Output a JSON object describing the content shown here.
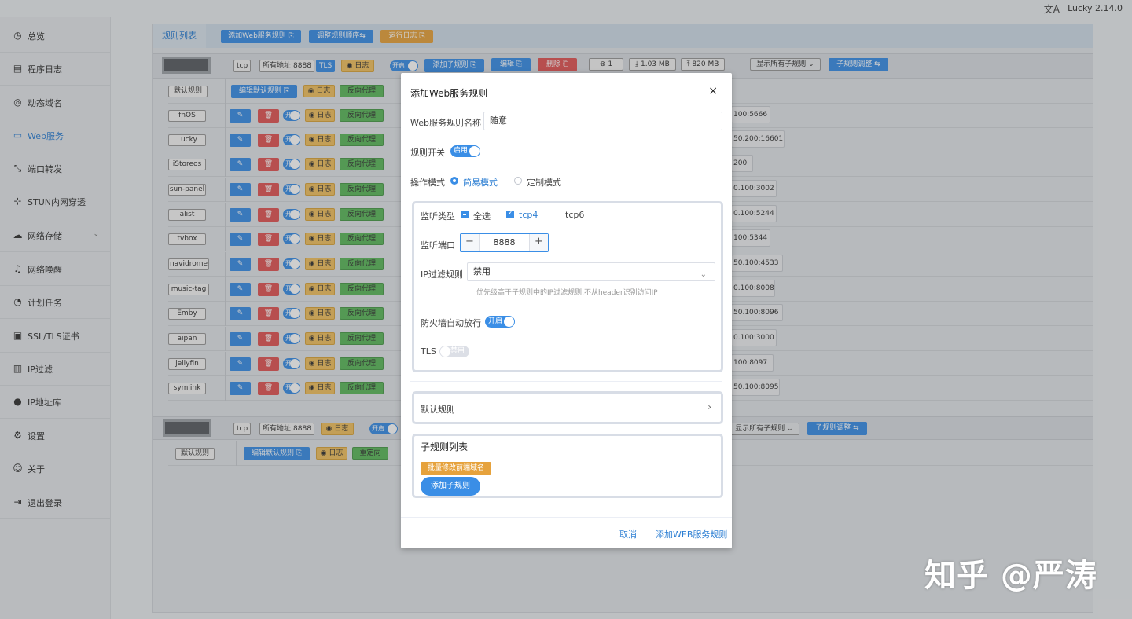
{
  "topbar": {
    "lang_icon": "文A",
    "version": "Lucky 2.14.0"
  },
  "sidebar": {
    "items": [
      {
        "label": "总览",
        "icon": "dashboard-icon",
        "glyph": "◷"
      },
      {
        "label": "程序日志",
        "icon": "log-icon",
        "glyph": "▤"
      },
      {
        "label": "动态域名",
        "icon": "ddns-icon",
        "glyph": "◎"
      },
      {
        "label": "Web服务",
        "icon": "web-icon",
        "glyph": "▭"
      },
      {
        "label": "端口转发",
        "icon": "port-forward-icon",
        "glyph": "⤡"
      },
      {
        "label": "STUN内网穿透",
        "icon": "stun-icon",
        "glyph": "⊹"
      },
      {
        "label": "网络存储",
        "icon": "storage-icon",
        "glyph": "☁"
      },
      {
        "label": "网络唤醒",
        "icon": "bell-icon",
        "glyph": "♫"
      },
      {
        "label": "计划任务",
        "icon": "clock-icon",
        "glyph": "◔"
      },
      {
        "label": "SSL/TLS证书",
        "icon": "cert-icon",
        "glyph": "▣"
      },
      {
        "label": "IP过滤",
        "icon": "filter-icon",
        "glyph": "▥"
      },
      {
        "label": "IP地址库",
        "icon": "user-icon",
        "glyph": "●"
      },
      {
        "label": "设置",
        "icon": "gear-icon",
        "glyph": "⚙"
      },
      {
        "label": "关于",
        "icon": "info-icon",
        "glyph": "☺"
      },
      {
        "label": "退出登录",
        "icon": "logout-icon",
        "glyph": "⇥"
      }
    ]
  },
  "toolbar": {
    "tab_label": "规则列表",
    "add_web_rule": "添加Web服务规则 ⎘",
    "adjust_order": "调整规则顺序⇆",
    "run_log": "运行日志 ⎘"
  },
  "rule1": {
    "protocol": "tcp",
    "address": "所有地址:8888",
    "tls": "TLS",
    "log": "◉ 日志",
    "enabled": "开启",
    "add_sub": "添加子规则 ⎘",
    "edit": "编辑 ⎘",
    "delete": "删除 ⎗",
    "conn": "⊗ 1",
    "down": "⤓ 1.03 MB",
    "up": "⤒ 820 MB",
    "show_all": "显示所有子规则 ⌄",
    "adjust_sub": "子规则调整 ⇆",
    "default_rule": "默认规则",
    "edit_default": "编辑默认规则 ⎘",
    "log_tag": "◉ 日志",
    "proxy_tag": "反向代理",
    "on": "开",
    "edit_glyph": "✎",
    "delete_glyph": "🗑",
    "subs": [
      {
        "name": "fnOS",
        "addr": "100:5666"
      },
      {
        "name": "Lucky",
        "addr": "50.200:16601"
      },
      {
        "name": "iStoreos",
        "addr": "200"
      },
      {
        "name": "sun-panel",
        "addr": "0.100:3002"
      },
      {
        "name": "alist",
        "addr": "0.100:5244"
      },
      {
        "name": "tvbox",
        "addr": "100:5344"
      },
      {
        "name": "navidrome",
        "addr": "50.100:4533"
      },
      {
        "name": "music-tag",
        "addr": "0.100:8008"
      },
      {
        "name": "Emby",
        "addr": "50.100:8096"
      },
      {
        "name": "aipan",
        "addr": "0.100:3000"
      },
      {
        "name": "jellyfin",
        "addr": "100:8097"
      },
      {
        "name": "symlink",
        "addr": "50.100:8095"
      }
    ]
  },
  "rule2": {
    "protocol": "tcp",
    "address": "所有地址:8888",
    "log": "◉ 日志",
    "enabled": "开启",
    "show_all": "显示所有子规则 ⌄",
    "adjust_sub": "子规则调整 ⇆",
    "default_rule": "默认规则",
    "edit_default": "编辑默认规则 ⎘",
    "log_tag": "◉ 日志",
    "redirect_tag": "重定向"
  },
  "modal": {
    "title": "添加Web服务规则",
    "close": "×",
    "name_label": "Web服务规则名称",
    "name_value": "随意",
    "switch_label": "规则开关",
    "switch_text": "启用",
    "mode_label": "操作模式",
    "mode_simple": "简易模式",
    "mode_custom": "定制模式",
    "listen_type_label": "监听类型",
    "all_label": "全选",
    "tcp4_label": "tcp4",
    "tcp6_label": "tcp6",
    "port_label": "监听端口",
    "port_value": "8888",
    "minus": "−",
    "plus": "+",
    "ipfilter_label": "IP过滤规则",
    "ipfilter_value": "禁用",
    "ipfilter_hint": "优先级高于子规则中的IP过滤规则,不从header识别访问IP",
    "firewall_label": "防火墙自动放行",
    "firewall_text": "开启",
    "tls_label": "TLS",
    "tls_text": "禁用",
    "default_rule_label": "默认规则",
    "sub_list_title": "子规则列表",
    "batch_btn": "批量修改前端域名",
    "add_sub_btn": "添加子规则",
    "cancel": "取消",
    "confirm": "添加WEB服务规则"
  },
  "watermark": "知乎 @严涛"
}
